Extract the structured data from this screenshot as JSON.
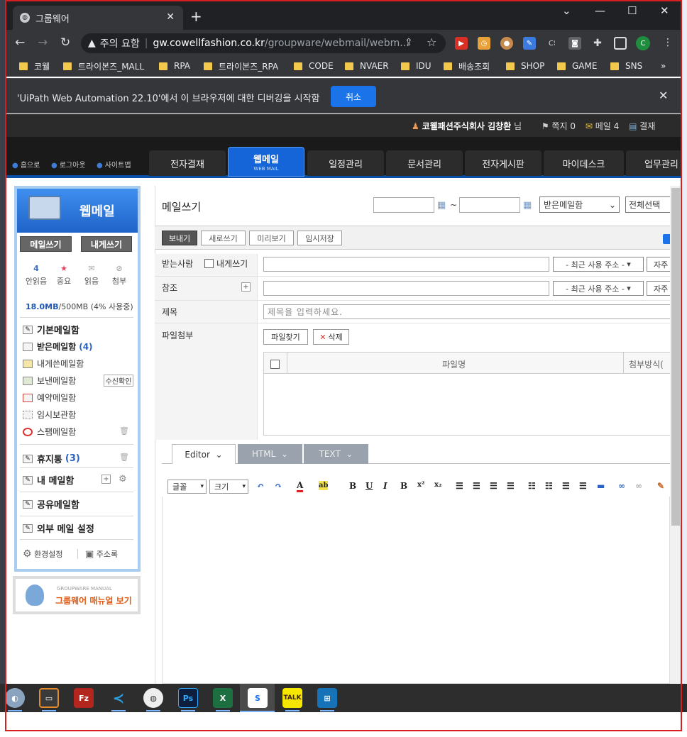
{
  "browser": {
    "tab_title": "그룹웨어",
    "new_tab": "+",
    "window_controls": {
      "minimize": "—",
      "maximize": "☐",
      "close": "✕"
    },
    "security_label": "주의 요함",
    "url_domain": "gw.cowellfashion.co.kr",
    "url_path": "/groupware/webmail/webm...",
    "profile_initial": "C",
    "bookmarks": [
      "코웰",
      "트라이본즈_MALL",
      "RPA",
      "트라이본즈_RPA",
      "CODE",
      "NVAER",
      "IDU",
      "배송조회",
      "SHOP",
      "GAME",
      "SNS"
    ],
    "bookmarks_more": "»",
    "infobar_text": "'UiPath Web Automation 22.10'에서 이 브라우저에 대한 디버깅을 시작함",
    "infobar_cancel": "취소"
  },
  "gw_header": {
    "company_user": "코웰패션주식회사 김창환",
    "user_suffix": "님",
    "note": "쪽지 0",
    "mail": "메일 4",
    "approval": "결재",
    "quick_links": [
      "홈으로",
      "로그아웃",
      "사이트맵"
    ],
    "menu": [
      "전자결재",
      "웹메일",
      "일정관리",
      "문서관리",
      "전자게시판",
      "마이데스크",
      "업무관리"
    ],
    "active_menu_sub": "WEB MAIL"
  },
  "sidebar": {
    "title": "웹메일",
    "write_btn": "메일쓰기",
    "self_btn": "내게쓰기",
    "counters": [
      {
        "value": "4",
        "label": "안읽음"
      },
      {
        "value": "",
        "label": "중요"
      },
      {
        "value": "",
        "label": "읽음"
      },
      {
        "value": "",
        "label": "첨부"
      }
    ],
    "quota_used": "18.0MB",
    "quota_rest": "/500MB (4% 사용중)",
    "basic_box": "기본메일함",
    "folders": [
      {
        "label": "받은메일함",
        "count": "(4)"
      },
      {
        "label": "내게쓴메일함",
        "count": ""
      },
      {
        "label": "보낸메일함",
        "count": ""
      },
      {
        "label": "예약메일함",
        "count": ""
      },
      {
        "label": "임시보관함",
        "count": ""
      },
      {
        "label": "스팸메일함",
        "count": ""
      }
    ],
    "receipt_btn": "수신확인",
    "trash": {
      "label": "휴지통",
      "count": "(3)"
    },
    "my_box": "내 메일함",
    "shared_box": "공유메일함",
    "external_box": "외부 메일 설정",
    "settings": "환경설정",
    "addressbook": "주소록",
    "manual_small": "GROUPWARE MANUAL",
    "manual_title": "그룹웨어 매뉴얼 보기"
  },
  "compose": {
    "title": "메일쓰기",
    "date_sep": "~",
    "mailbox_select": "받은메일함",
    "select_all": "전체선택",
    "buttons": [
      "보내기",
      "새로쓰기",
      "미리보기",
      "임시저장"
    ],
    "to_label": "받는사람",
    "to_self": "내게쓰기",
    "cc_label": "참조",
    "subject_label": "제목",
    "subject_placeholder": "제목을 입력하세요.",
    "attach_label": "파일첨부",
    "recent_addr": "- 최근 사용 주소 -",
    "frequent": "자주",
    "find_file": "파일찾기",
    "delete": "삭제",
    "file_col": "파일명",
    "attach_type_col": "첨부방식(",
    "editor_tabs": [
      "Editor",
      "HTML",
      "TEXT"
    ],
    "font_select": "글꼴",
    "size_select": "크기"
  }
}
